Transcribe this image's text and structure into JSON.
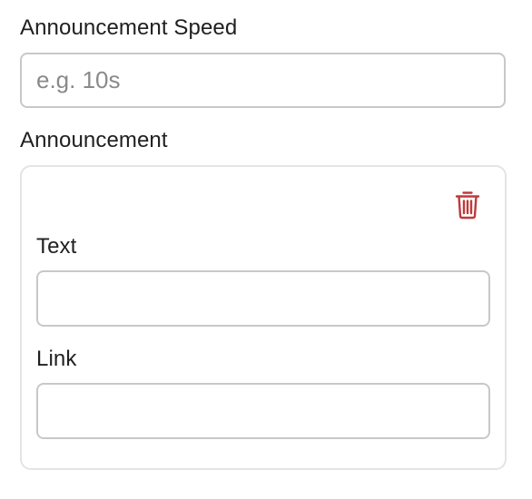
{
  "speed": {
    "label": "Announcement Speed",
    "placeholder": "e.g. 10s",
    "value": ""
  },
  "announcement": {
    "label": "Announcement",
    "delete_icon": "trash-icon",
    "delete_color": "#c0393b",
    "text_field": {
      "label": "Text",
      "value": ""
    },
    "link_field": {
      "label": "Link",
      "value": ""
    }
  }
}
